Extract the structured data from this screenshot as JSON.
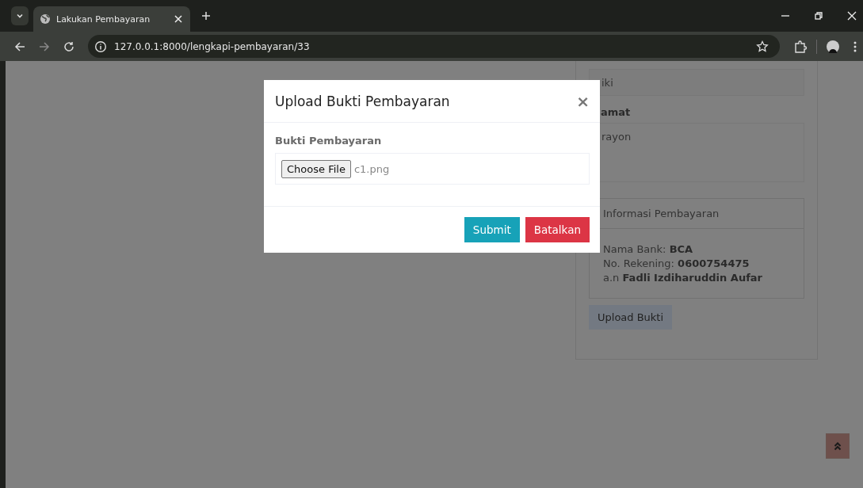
{
  "browser": {
    "tab_title": "Lakukan Pembayaran",
    "url": "127.0.0.1:8000/lengkapi-pembayaran/33"
  },
  "page": {
    "name_value": "iki",
    "address_label": "amat",
    "address_value": "rayon",
    "info_title": "Informasi Pembayaran",
    "info_lines": [
      {
        "label": "Nama Bank: ",
        "value": "BCA"
      },
      {
        "label": "No. Rekening: ",
        "value": "0600754475"
      },
      {
        "label": "a.n ",
        "value": "Fadli Izdiharuddin Aufar"
      }
    ],
    "upload_button": "Upload Bukti"
  },
  "modal": {
    "title": "Upload Bukti Pembayaran",
    "close": "×",
    "field_label": "Bukti Pembayaran",
    "file_button": "Choose File",
    "file_name": "c1.png",
    "buttons": [
      {
        "label": "Submit",
        "kind": "primary"
      },
      {
        "label": "Batalkan",
        "kind": "danger"
      }
    ]
  }
}
